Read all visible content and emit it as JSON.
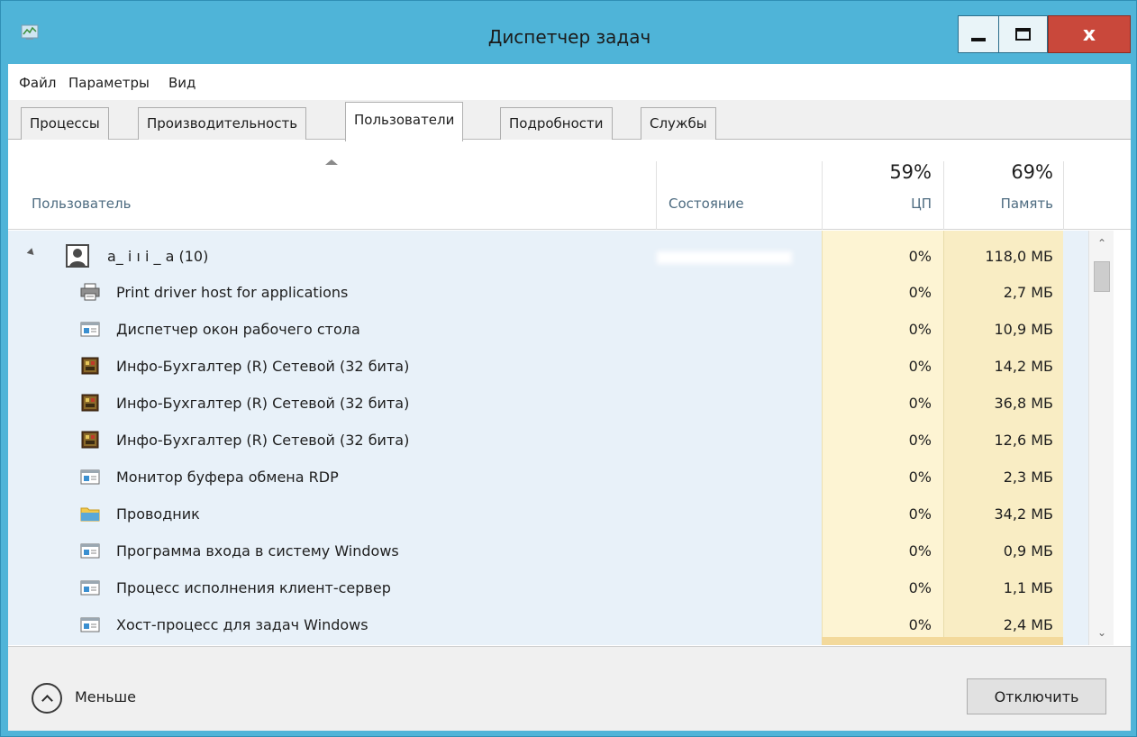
{
  "window": {
    "title": "Диспетчер задач",
    "close_label": "x"
  },
  "menu": {
    "items": [
      "Файл",
      "Параметры",
      "Вид"
    ]
  },
  "tabs": [
    {
      "label": "Процессы",
      "active": false
    },
    {
      "label": "Производительность",
      "active": false
    },
    {
      "label": "Пользователи",
      "active": true
    },
    {
      "label": "Подробности",
      "active": false
    },
    {
      "label": "Службы",
      "active": false
    }
  ],
  "header": {
    "user_col": "Пользователь",
    "state_col": "Состояние",
    "cpu_total": "59%",
    "cpu_col": "ЦП",
    "mem_total": "69%",
    "mem_col": "Память"
  },
  "user_row": {
    "name": "a_ i ı i _ a (10)",
    "cpu": "0%",
    "mem": "118,0 МБ"
  },
  "processes": [
    {
      "name": "Print driver host for applications",
      "cpu": "0%",
      "mem": "2,7 МБ",
      "icon": "printer-icon"
    },
    {
      "name": "Диспетчер окон рабочего стола",
      "cpu": "0%",
      "mem": "10,9 МБ",
      "icon": "window-app-icon"
    },
    {
      "name": "Инфо-Бухгалтер (R) Сетевой (32 бита)",
      "cpu": "0%",
      "mem": "14,2 МБ",
      "icon": "accounting-app-icon"
    },
    {
      "name": "Инфо-Бухгалтер (R) Сетевой (32 бита)",
      "cpu": "0%",
      "mem": "36,8 МБ",
      "icon": "accounting-app-icon"
    },
    {
      "name": "Инфо-Бухгалтер (R) Сетевой (32 бита)",
      "cpu": "0%",
      "mem": "12,6 МБ",
      "icon": "accounting-app-icon"
    },
    {
      "name": "Монитор буфера обмена RDP",
      "cpu": "0%",
      "mem": "2,3 МБ",
      "icon": "window-app-icon"
    },
    {
      "name": "Проводник",
      "cpu": "0%",
      "mem": "34,2 МБ",
      "icon": "folder-icon"
    },
    {
      "name": "Программа входа в систему Windows",
      "cpu": "0%",
      "mem": "0,9 МБ",
      "icon": "window-app-icon"
    },
    {
      "name": "Процесс исполнения клиент-сервер",
      "cpu": "0%",
      "mem": "1,1 МБ",
      "icon": "window-app-icon"
    },
    {
      "name": "Хост-процесс для задач Windows",
      "cpu": "0%",
      "mem": "2,4 МБ",
      "icon": "window-app-icon"
    }
  ],
  "footer": {
    "less_label": "Меньше",
    "disconnect_label": "Отключить"
  },
  "colors": {
    "title_bar": "#4fb4d8",
    "close_button": "#c9483b",
    "row_bg": "#e8f1f9",
    "cpu_col_bg": "#fdf4d3",
    "mem_col_bg": "#f9edc4"
  }
}
